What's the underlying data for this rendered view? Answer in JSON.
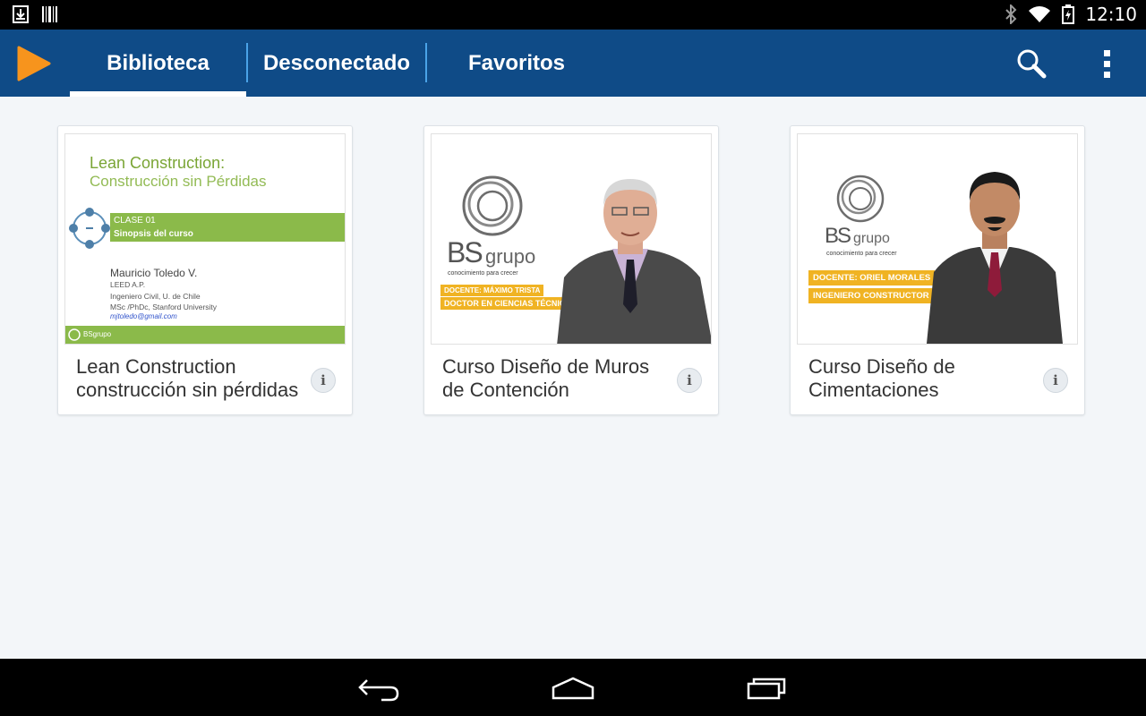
{
  "status_bar": {
    "time": "12:10",
    "icons": [
      "download-icon",
      "barcode-icon",
      "bluetooth-icon",
      "wifi-icon",
      "battery-icon"
    ]
  },
  "app_bar": {
    "logo_icon": "play-logo-icon",
    "accent_color": "#f7941d",
    "background_color": "#0f4b87",
    "tabs": [
      {
        "label": "Biblioteca",
        "selected": true
      },
      {
        "label": "Desconectado",
        "selected": false
      },
      {
        "label": "Favoritos",
        "selected": false
      }
    ],
    "actions": [
      "search-icon",
      "more-vert-icon"
    ]
  },
  "courses": [
    {
      "title": "Lean Construction construcción sin pérdidas",
      "info_label": "i",
      "thumbnail": {
        "heading_line1": "Lean Construction:",
        "heading_line2": "Construcción sin Pérdidas",
        "clase": "CLASE 01",
        "subtitle": "Sinopsis del curso",
        "teacher": "Mauricio Toledo V.",
        "line1": "LEED A.P.",
        "line2": "Ingeniero Civil, U. de Chile",
        "line3": "MSc /PhDc, Stanford University",
        "email": "mjtoledo@gmail.com",
        "footer_brand": "BSgrupo"
      }
    },
    {
      "title": "Curso Diseño de Muros de Contención",
      "info_label": "i",
      "thumbnail": {
        "brand_bs": "BS",
        "brand_grupo": "grupo",
        "tagline": "conocimiento para crecer",
        "label1": "DOCENTE: MÁXIMO TRISTA",
        "label2": "DOCTOR EN CIENCIAS TÉCNICAS"
      }
    },
    {
      "title": "Curso Diseño de Cimentaciones",
      "info_label": "i",
      "thumbnail": {
        "brand_bs": "BS",
        "brand_grupo": "grupo",
        "tagline": "conocimiento para crecer",
        "label1": "DOCENTE: ORIEL MORALES",
        "label2": "INGENIERO CONSTRUCTOR"
      }
    }
  ],
  "nav_bar": {
    "buttons": [
      "back-icon",
      "home-icon",
      "recents-icon"
    ]
  }
}
